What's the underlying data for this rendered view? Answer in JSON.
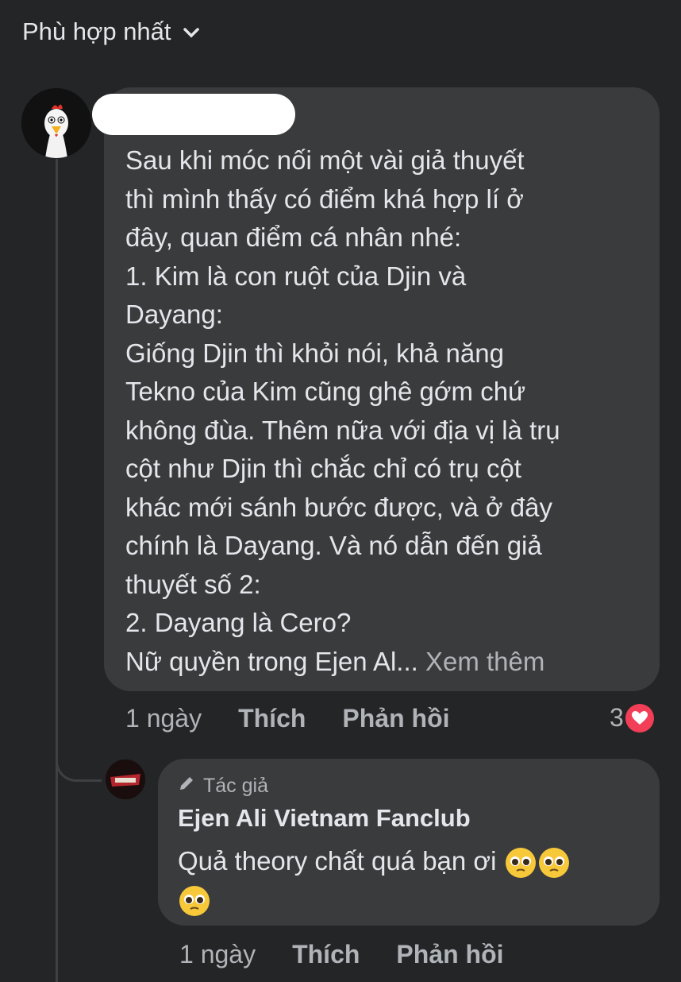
{
  "sort": {
    "label": "Phù hợp nhất"
  },
  "comment": {
    "text": "Sau khi móc nối một vài giả thuyết\nthì mình thấy có điểm khá hợp lí ở\nđây, quan điểm cá nhân nhé:\n1. Kim là con ruột của Djin và\nDayang:\nGiống Djin thì khỏi nói, khả năng\nTekno của Kim cũng ghê gớm chứ\nkhông đùa. Thêm nữa với địa vị là trụ\ncột như Djin thì chắc chỉ có trụ cột\nkhác mới sánh bước được, và ở đây\nchính là Dayang. Và nó dẫn đến giả\nthuyết số 2:\n2. Dayang là Cero?\nNữ quyền trong Ejen Al... ",
    "see_more": "Xem thêm",
    "time": "1 ngày",
    "like": "Thích",
    "reply": "Phản hồi",
    "reaction_count": "3",
    "reaction_icon": "heart-icon",
    "reaction_color": "#f33e58"
  },
  "reply": {
    "badge": "Tác giả",
    "author": "Ejen Ali Vietnam Fanclub",
    "text": "Quả theory chất quá bạn ơi",
    "emoji": "pleading-face-emoji",
    "time": "1 ngày",
    "like": "Thích",
    "reply": "Phản hồi"
  },
  "theme": {
    "background": "#242526",
    "bubble": "#3a3b3c",
    "text": "#e4e6eb",
    "secondary": "#b0b3b8"
  }
}
